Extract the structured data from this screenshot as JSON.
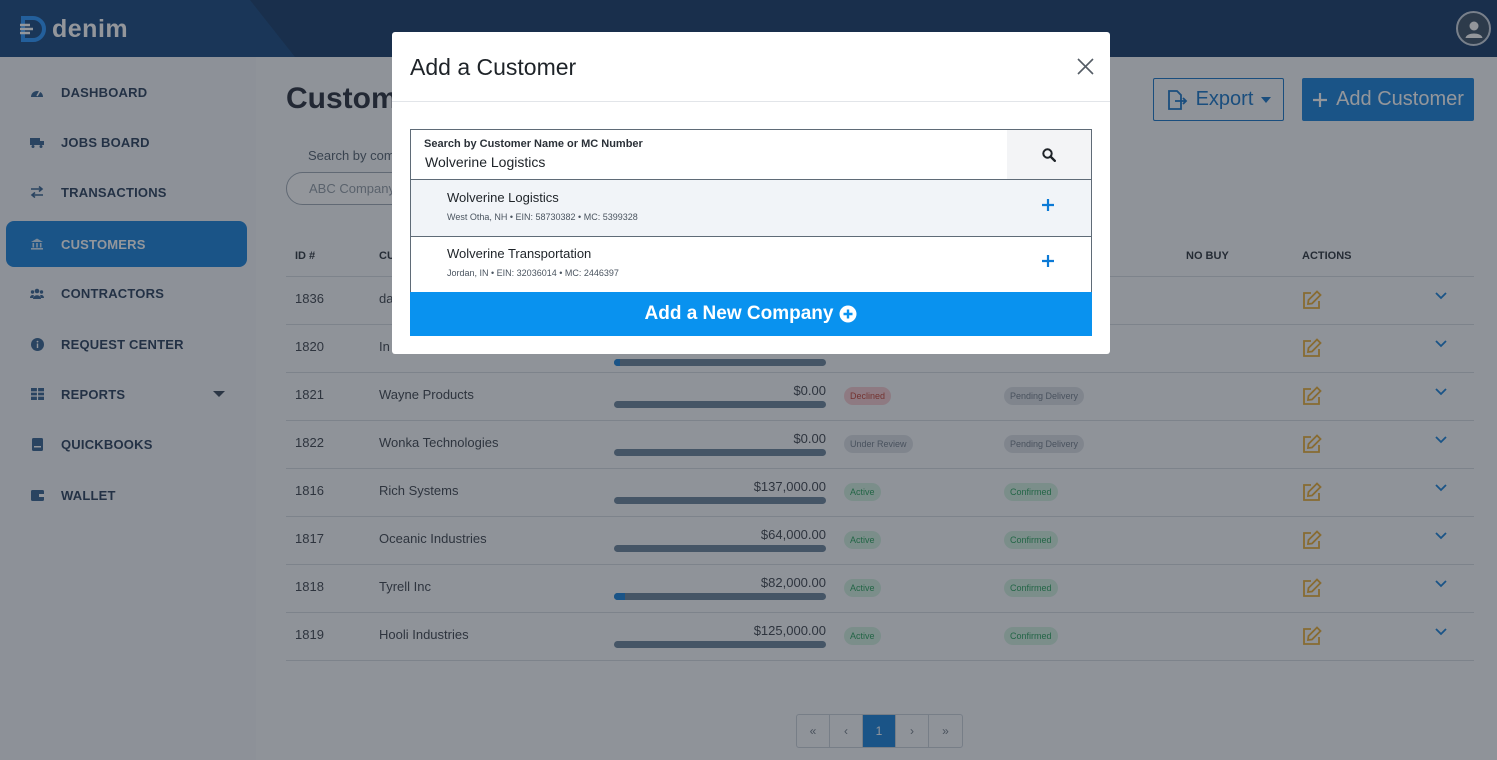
{
  "app": {
    "brand": "denim"
  },
  "sidebar": {
    "items": [
      {
        "label": "DASHBOARD",
        "icon": "dashboard-icon"
      },
      {
        "label": "JOBS BOARD",
        "icon": "truck-icon"
      },
      {
        "label": "TRANSACTIONS",
        "icon": "exchange-icon"
      },
      {
        "label": "CUSTOMERS",
        "icon": "building-icon",
        "active": true
      },
      {
        "label": "CONTRACTORS",
        "icon": "users-icon"
      },
      {
        "label": "REQUEST CENTER",
        "icon": "info-icon"
      },
      {
        "label": "REPORTS",
        "icon": "table-icon",
        "has_dropdown": true
      },
      {
        "label": "QUICKBOOKS",
        "icon": "book-icon"
      },
      {
        "label": "WALLET",
        "icon": "wallet-icon"
      }
    ]
  },
  "main": {
    "title": "Custome",
    "export_label": "Export",
    "add_customer_label": "Add Customer",
    "search_label": "Search by comp",
    "search_placeholder": "ABC Company",
    "columns": [
      "ID #",
      "CU",
      "",
      "",
      "NO BUY",
      "ACTIONS"
    ],
    "rows": [
      {
        "id": "1836",
        "name": "da",
        "amount": "",
        "bar": null,
        "status": "",
        "delivery": ""
      },
      {
        "id": "1820",
        "name": "In",
        "amount": "",
        "bar": 0.03,
        "status": "",
        "delivery": ""
      },
      {
        "id": "1821",
        "name": "Wayne Products",
        "amount": "$0.00",
        "bar": 0,
        "status": "Declined",
        "delivery": "Pending Delivery"
      },
      {
        "id": "1822",
        "name": "Wonka Technologies",
        "amount": "$0.00",
        "bar": 0,
        "status": "Under Review",
        "delivery": "Pending Delivery"
      },
      {
        "id": "1816",
        "name": "Rich Systems",
        "amount": "$137,000.00",
        "bar": 0,
        "status": "Active",
        "delivery": "Confirmed"
      },
      {
        "id": "1817",
        "name": "Oceanic Industries",
        "amount": "$64,000.00",
        "bar": 0,
        "status": "Active",
        "delivery": "Confirmed"
      },
      {
        "id": "1818",
        "name": "Tyrell Inc",
        "amount": "$82,000.00",
        "bar": 0.05,
        "status": "Active",
        "delivery": "Confirmed"
      },
      {
        "id": "1819",
        "name": "Hooli Industries",
        "amount": "$125,000.00",
        "bar": 0,
        "status": "Active",
        "delivery": "Confirmed"
      }
    ],
    "pager": {
      "first": "«",
      "prev": "‹",
      "current": "1",
      "next": "›",
      "last": "»"
    }
  },
  "modal": {
    "title": "Add a Customer",
    "search_label": "Search by Customer Name or MC Number",
    "search_value": "Wolverine Logistics",
    "results": [
      {
        "name": "Wolverine Logistics",
        "meta": "West Otha, NH • EIN: 58730382 • MC: 5399328"
      },
      {
        "name": "Wolverine Transportation",
        "meta": "Jordan, IN • EIN: 32036014 • MC: 2446397"
      }
    ],
    "add_new_label": "Add a New Company"
  },
  "colors": {
    "brand_blue": "#0c7ad6",
    "new_company_blue": "#0992ef",
    "topbar": "#0a3160",
    "declined": "#f4c7cc",
    "active": "#cfeedd",
    "edit_icon": "#e8a82a"
  }
}
